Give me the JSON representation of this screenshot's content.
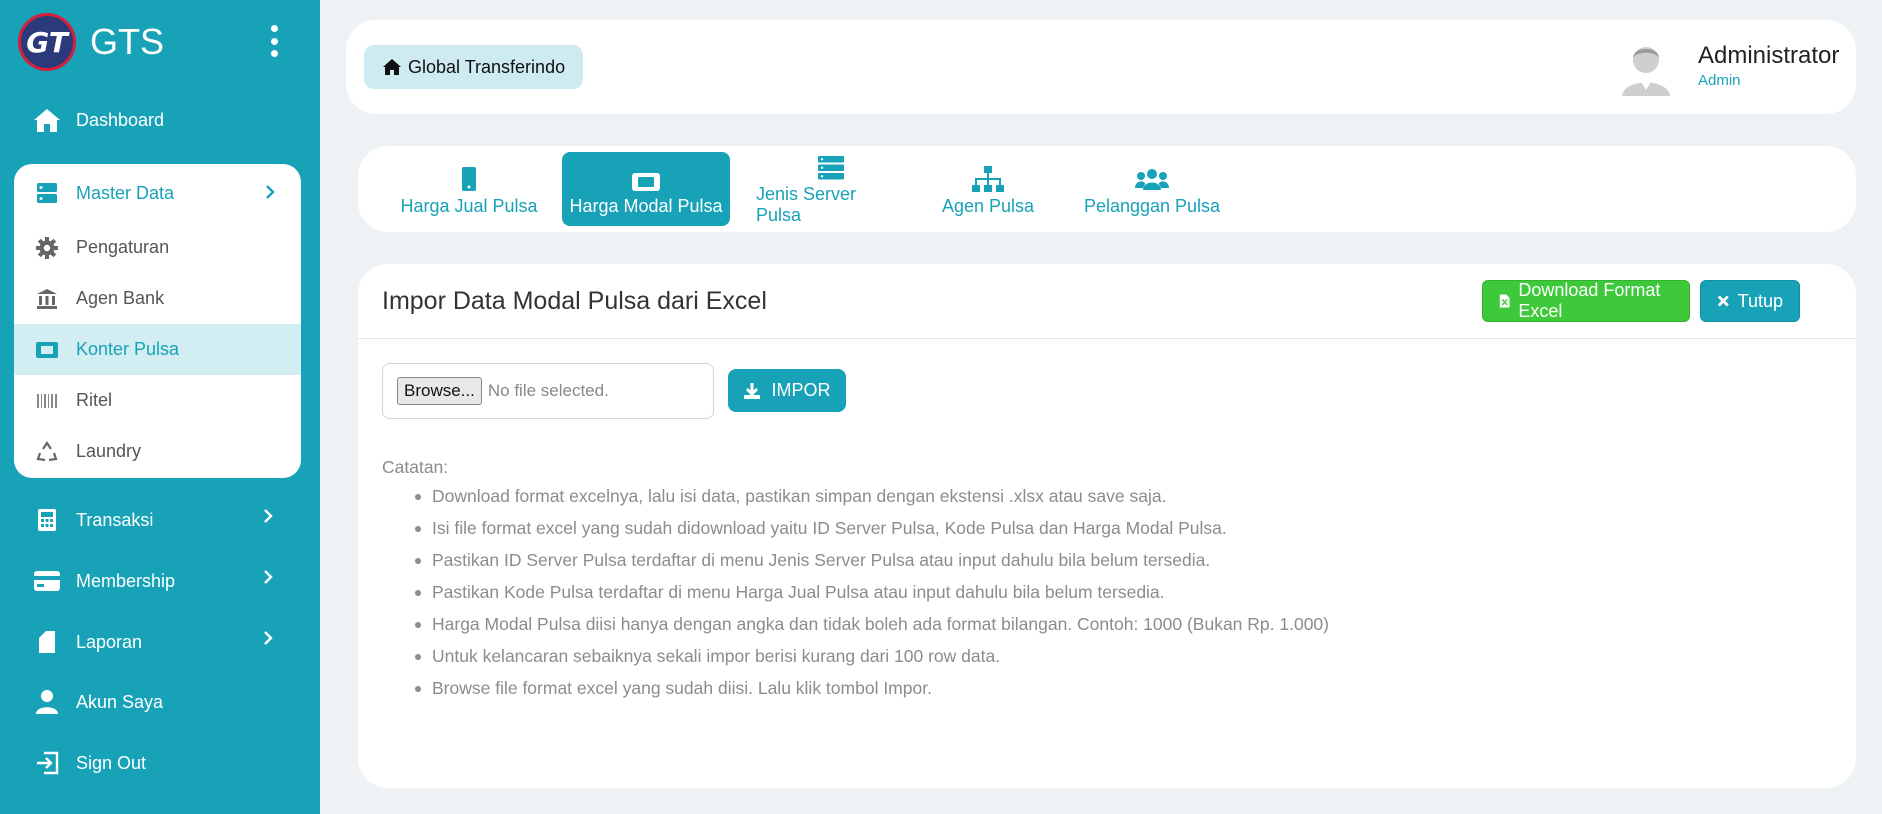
{
  "brand": {
    "logo_text": "GT",
    "name": "GTS"
  },
  "sidebar": {
    "dashboard": "Dashboard",
    "master": {
      "label": "Master Data",
      "items": [
        {
          "label": "Pengaturan",
          "icon": "gear-icon"
        },
        {
          "label": "Agen Bank",
          "icon": "bank-icon"
        },
        {
          "label": "Konter Pulsa",
          "icon": "ticket-icon",
          "active": true
        },
        {
          "label": "Ritel",
          "icon": "barcode-icon"
        },
        {
          "label": "Laundry",
          "icon": "recycle-icon"
        }
      ]
    },
    "transaksi": "Transaksi",
    "membership": "Membership",
    "laporan": "Laporan",
    "akun": "Akun Saya",
    "signout": "Sign Out"
  },
  "header": {
    "breadcrumb": "Global Transferindo",
    "user_name": "Administrator",
    "user_role": "Admin"
  },
  "tabs": [
    {
      "label": "Harga Jual Pulsa",
      "icon": "mobile-icon"
    },
    {
      "label": "Harga Modal Pulsa",
      "icon": "ticket-icon",
      "active": true
    },
    {
      "label": "Jenis Server Pulsa",
      "icon": "server-icon"
    },
    {
      "label": "Agen Pulsa",
      "icon": "sitemap-icon"
    },
    {
      "label": "Pelanggan Pulsa",
      "icon": "users-icon"
    }
  ],
  "main": {
    "title": "Impor Data Modal Pulsa dari Excel",
    "download_label": "Download Format Excel",
    "close_label": "Tutup",
    "browse_label": "Browse...",
    "no_file_label": "No file selected.",
    "import_label": "IMPOR",
    "notes_label": "Catatan:",
    "notes": [
      "Download format excelnya, lalu isi data, pastikan simpan dengan ekstensi .xlsx atau save saja.",
      "Isi file format excel yang sudah didownload yaitu ID Server Pulsa, Kode Pulsa dan Harga Modal Pulsa.",
      "Pastikan ID Server Pulsa terdaftar di menu Jenis Server Pulsa atau input dahulu bila belum tersedia.",
      "Pastikan Kode Pulsa terdaftar di menu Harga Jual Pulsa atau input dahulu bila belum tersedia.",
      "Harga Modal Pulsa diisi hanya dengan angka dan tidak boleh ada format bilangan. Contoh: 1000 (Bukan Rp. 1.000)",
      "Untuk kelancaran sebaiknya sekali impor berisi kurang dari 100 row data.",
      "Browse file format excel yang sudah diisi. Lalu klik tombol Impor."
    ]
  },
  "colors": {
    "primary": "#17a2b8",
    "success": "#3dc93a",
    "active_bg": "#d2eef2"
  }
}
